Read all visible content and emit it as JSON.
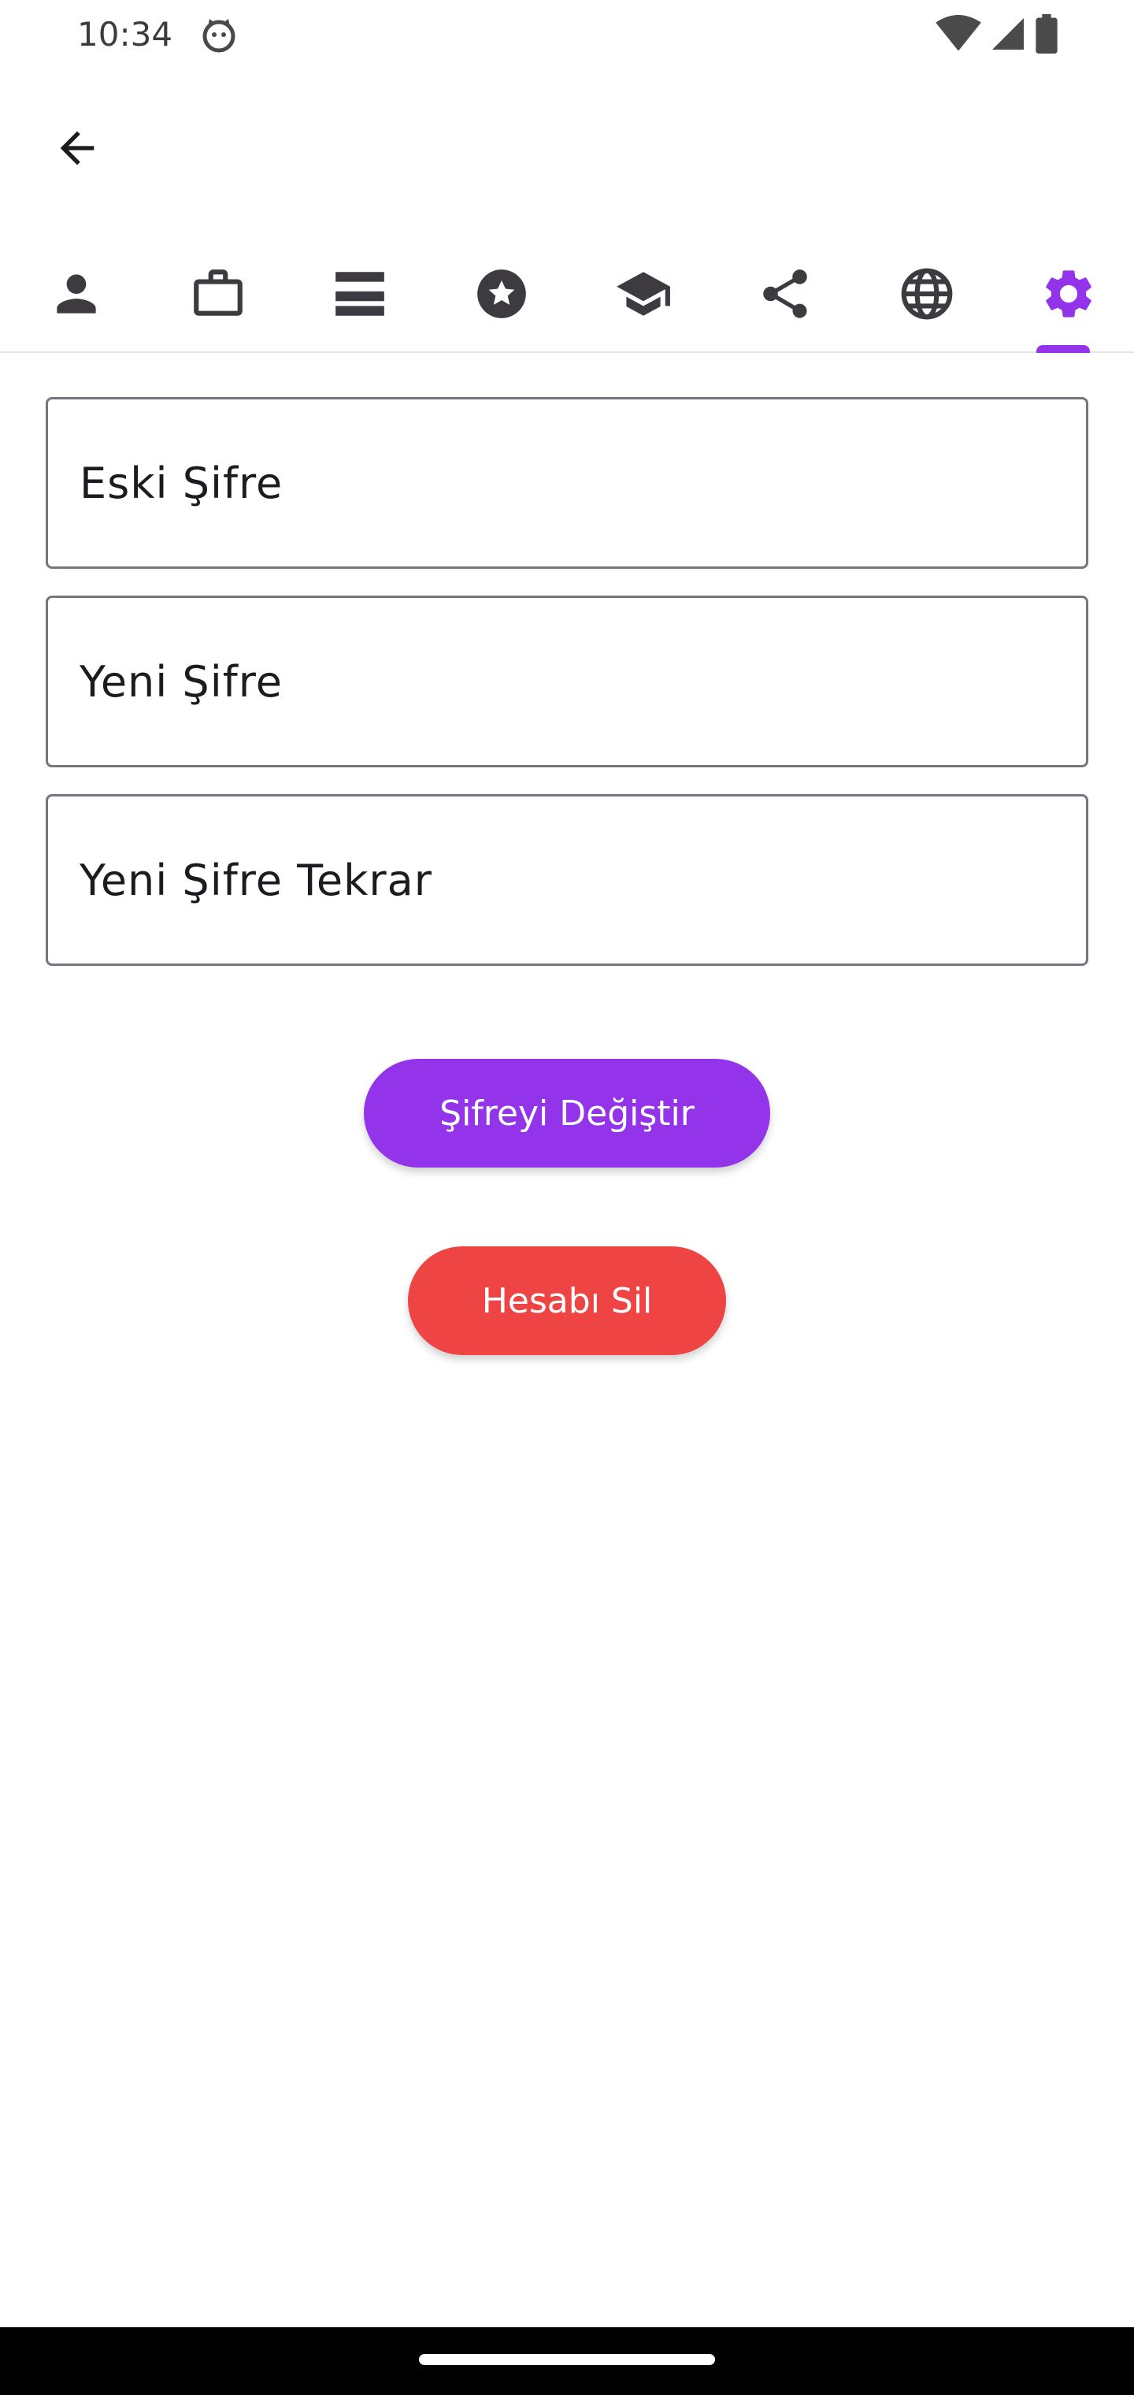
{
  "status_bar": {
    "time": "10:34"
  },
  "app_bar": {
    "back_icon": "arrow-back-icon"
  },
  "tabs": [
    {
      "icon": "person-icon",
      "selected": false
    },
    {
      "icon": "briefcase-icon",
      "selected": false
    },
    {
      "icon": "storage-icon",
      "selected": false
    },
    {
      "icon": "star-badge-icon",
      "selected": false
    },
    {
      "icon": "school-icon",
      "selected": false
    },
    {
      "icon": "share-icon",
      "selected": false
    },
    {
      "icon": "globe-icon",
      "selected": false
    },
    {
      "icon": "settings-gear-icon",
      "selected": true
    }
  ],
  "form": {
    "old_password_label": "Eski Şifre",
    "new_password_label": "Yeni Şifre",
    "repeat_password_label": "Yeni Şifre Tekrar"
  },
  "buttons": {
    "change_password": "Şifreyi Değiştir",
    "delete_account": "Hesabı Sil"
  },
  "colors": {
    "accent": "#9334ea",
    "danger": "#ef4444",
    "icon": "#3d3a40",
    "outline": "#79747e"
  }
}
